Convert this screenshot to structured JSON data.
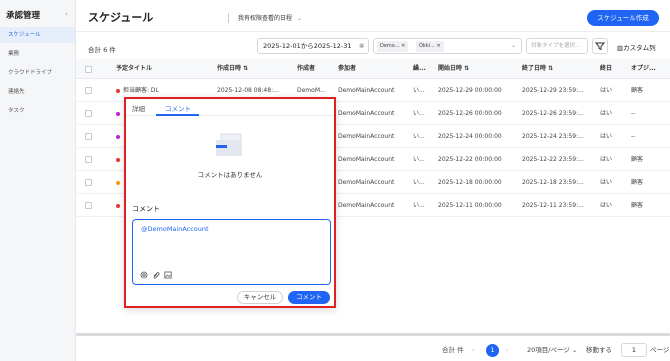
{
  "sidebar": {
    "title": "承認管理",
    "items": [
      {
        "label": "スケジュール",
        "active": true
      },
      {
        "label": "業務",
        "active": false
      },
      {
        "label": "クラウドドライブ",
        "active": false
      },
      {
        "label": "連絡先",
        "active": false
      },
      {
        "label": "タスク",
        "active": false
      }
    ]
  },
  "header": {
    "title": "スケジュール",
    "view_label": "我有权限查看的日程",
    "create_label": "スケジュール作成"
  },
  "toolbar": {
    "count": "合計 6 件",
    "date_range": "2025-12-01から2025-12-31",
    "tags": [
      "Demo...",
      "Okki..."
    ],
    "type_placeholder": "対象タイプを選択...",
    "custom_columns": "カスタム列"
  },
  "table": {
    "columns": [
      "予定タイトル",
      "作成日時",
      "作成者",
      "参加者",
      "繰...",
      "開始日時",
      "終了日時",
      "終日",
      "オプジ..."
    ],
    "rows": [
      {
        "dot": "#e53935",
        "title": "担当顧客: DL",
        "created": "2025-12-08 08:48:...",
        "creator": "DemoM...",
        "participant": "DemoMainAccount",
        "repeat": "い...",
        "start": "2025-12-29 00:00:00",
        "end": "2025-12-29 23:59:...",
        "allday": "はい",
        "object": "顧客"
      },
      {
        "dot": "#c026d3",
        "title": "",
        "created": "",
        "creator": "",
        "participant": "DemoMainAccount",
        "repeat": "い...",
        "start": "2025-12-26 00:00:00",
        "end": "2025-12-26 23:59:...",
        "allday": "はい",
        "object": "--"
      },
      {
        "dot": "#c026d3",
        "title": "",
        "created": "",
        "creator": "",
        "participant": "DemoMainAccount",
        "repeat": "い...",
        "start": "2025-12-24 00:00:00",
        "end": "2025-12-24 23:59:...",
        "allday": "はい",
        "object": "--"
      },
      {
        "dot": "#e53935",
        "title": "",
        "created": "",
        "creator": "",
        "participant": "DemoMainAccount",
        "repeat": "い...",
        "start": "2025-12-22 00:00:00",
        "end": "2025-12-22 23:59:...",
        "allday": "はい",
        "object": "顧客"
      },
      {
        "dot": "#f59e0b",
        "title": "",
        "created": "",
        "creator": "",
        "participant": "DemoMainAccount",
        "repeat": "い...",
        "start": "2025-12-18 00:00:00",
        "end": "2025-12-18 23:59:...",
        "allday": "はい",
        "object": "顧客"
      },
      {
        "dot": "#e53935",
        "title": "",
        "created": "",
        "creator": "",
        "participant": "DemoMainAccount",
        "repeat": "い...",
        "start": "2025-12-11 00:00:00",
        "end": "2025-12-11 23:59:...",
        "allday": "はい",
        "object": "顧客"
      }
    ]
  },
  "pager": {
    "total": "合計 件",
    "current_page": "1",
    "page_size": "20項目/ページ",
    "goto_label": "移動する",
    "goto_value": "1",
    "page_unit": "ページ"
  },
  "popover": {
    "tabs": [
      "詳細",
      "コメント"
    ],
    "empty_text": "コメントはありません",
    "comment_label": "コメント",
    "comment_value": "@DemoMainAccount",
    "cancel_label": "キャンセル",
    "submit_label": "コメント"
  },
  "colors": {
    "accent": "#1f64f2",
    "highlight": "#e02020"
  },
  "icons": [
    "chevron-down-icon",
    "calendar-icon",
    "filter-icon",
    "columns-icon",
    "sort-icon",
    "mention-icon",
    "attach-icon",
    "image-icon",
    "empty-folder-icon"
  ]
}
